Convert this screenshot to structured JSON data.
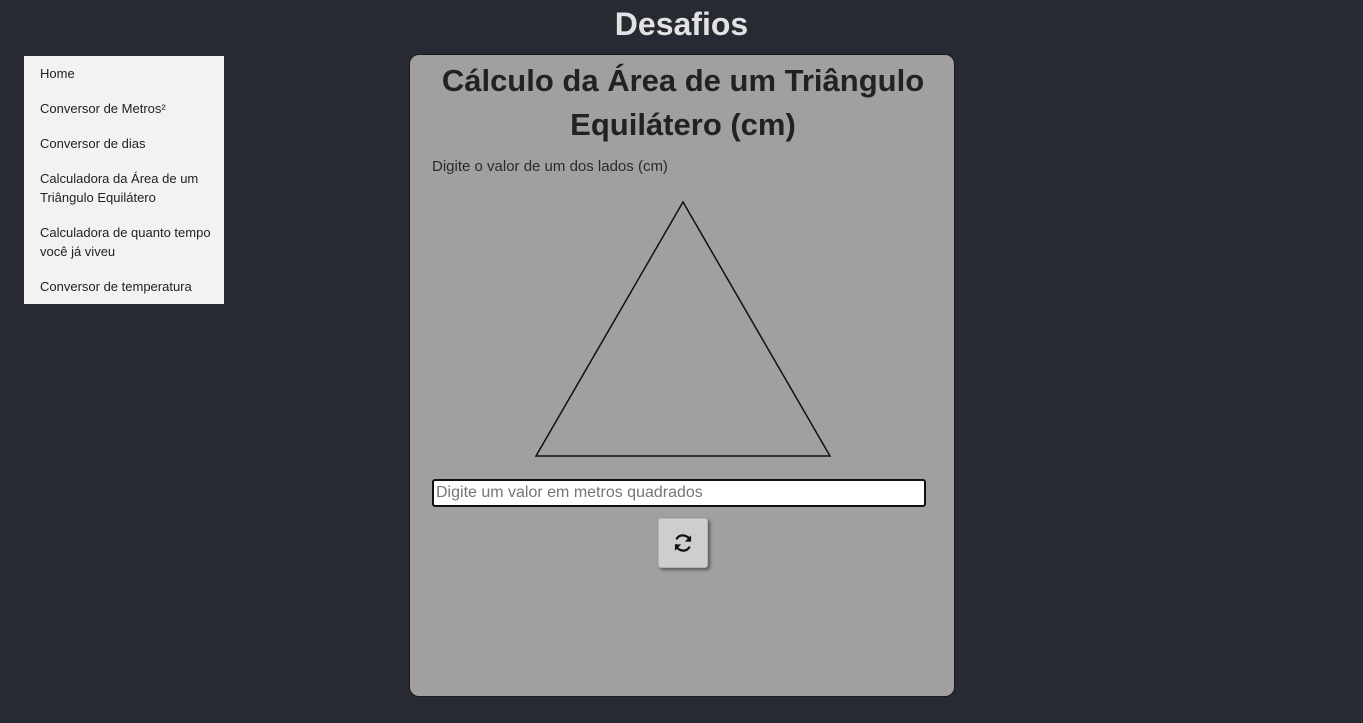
{
  "header": {
    "title": "Desafios"
  },
  "sidebar": {
    "items": [
      {
        "label": "Home"
      },
      {
        "label": "Conversor de Metros²"
      },
      {
        "label": "Conversor de dias"
      },
      {
        "label": "Calculadora da Área de um Triângulo Equilátero"
      },
      {
        "label": "Calculadora de quanto tempo você já viveu"
      },
      {
        "label": "Conversor de temperatura"
      }
    ]
  },
  "main": {
    "title": "Cálculo da Área de um Triângulo Equilátero (cm)",
    "side_label": "Digite o valor de um dos lados (cm)",
    "input": {
      "value": "",
      "placeholder": "Digite um valor em metros quadrados"
    },
    "refresh_icon": "refresh-icon"
  },
  "colors": {
    "background": "#272a33",
    "card": "#a19f9f",
    "sidebar": "#f2f2f2",
    "title": "#e2e2e2"
  }
}
